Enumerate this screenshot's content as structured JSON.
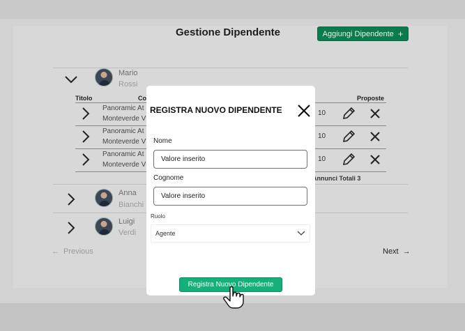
{
  "header": {
    "title": "Gestione Dipendente",
    "add_button_label": "Aggiungi Dipendente",
    "add_button_icon": "plus-icon"
  },
  "employees": [
    {
      "first_name": "Mario",
      "last_name": "Rossi",
      "expanded": true
    },
    {
      "first_name": "Anna",
      "last_name": "Bianchi",
      "expanded": false
    },
    {
      "first_name": "Luigi",
      "last_name": "Verdi",
      "expanded": false
    }
  ],
  "table": {
    "headers": {
      "title": "Titolo",
      "co": "Co",
      "proposals": "Proposte"
    },
    "rows": [
      {
        "line1": "Panoramic At",
        "line2": "Monteverde V",
        "value": "10"
      },
      {
        "line1": "Panoramic At",
        "line2": "Monteverde V",
        "value": "10"
      },
      {
        "line1": "Panoramic At",
        "line2": "Monteverde V",
        "value": "10"
      }
    ],
    "totals": "Annunci Totali 3"
  },
  "pagination": {
    "prev": "Previous",
    "next": "Next"
  },
  "modal": {
    "title": "REGISTRA NUOVO DIPENDENTE",
    "name_label": "Nome",
    "name_value": "Valore inserito",
    "surname_label": "Cognome",
    "surname_value": "Valore inserito",
    "role_label": "Ruolo",
    "role_value": "Agente",
    "submit_label": "Registra Nuovo Dipendente"
  },
  "colors": {
    "primary_dark": "#0b7a4e",
    "primary": "#14b07a",
    "overlay": "#d8d8d8",
    "modal_bg": "#ffffff"
  }
}
